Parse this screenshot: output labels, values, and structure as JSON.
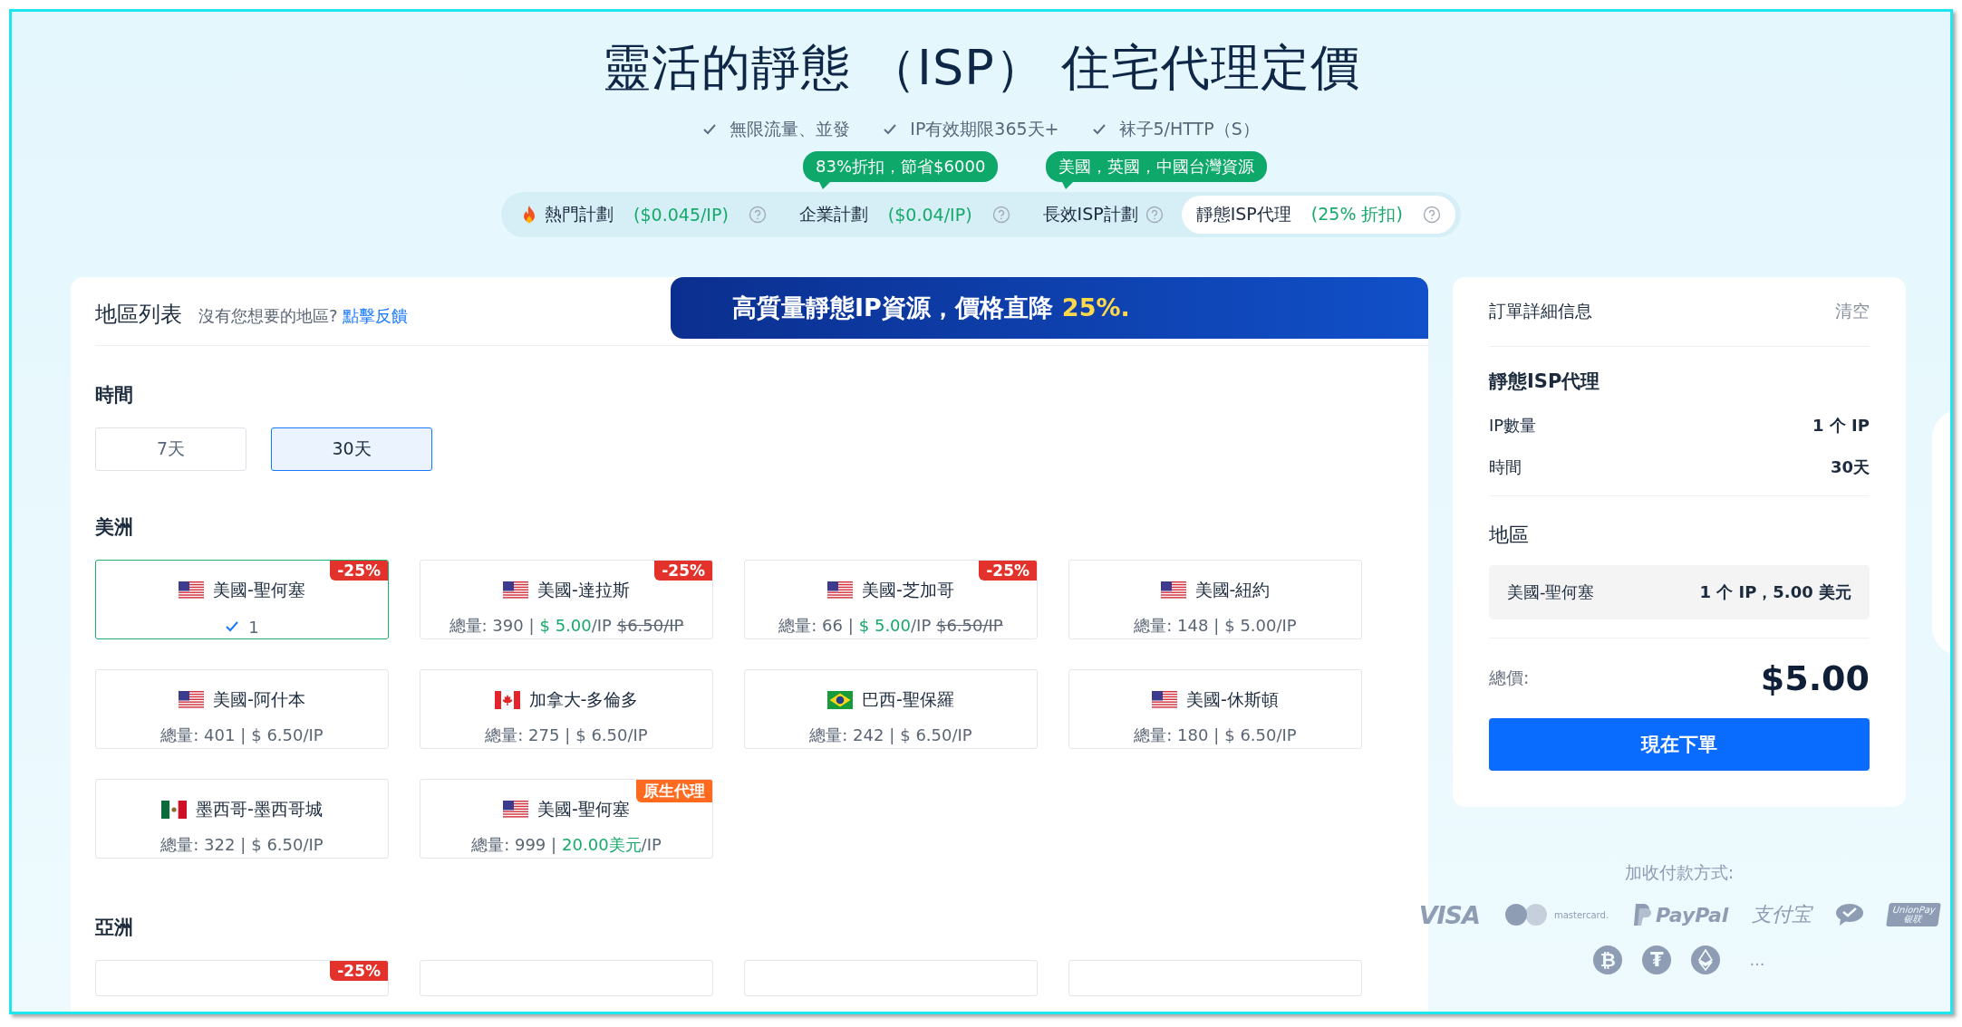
{
  "header": {
    "title": "靈活的靜態 （ISP） 住宅代理定價",
    "features": [
      "無限流量、並發",
      "IP有效期限365天+",
      "袜子5/HTTP（S）"
    ]
  },
  "plans": [
    {
      "kind": "hot",
      "label": "熱門計劃",
      "price": "($0.045/IP)",
      "selected": false
    },
    {
      "kind": "plain",
      "label": "企業計劃",
      "price": "($0.04/IP)",
      "tooltip": "83%折扣，節省$6000",
      "selected": false
    },
    {
      "kind": "plain",
      "label": "長效ISP計劃",
      "tooltip": "美國，英國，中國台灣資源",
      "selected": false
    },
    {
      "kind": "plain",
      "label": "靜態ISP代理",
      "price": "(25% 折扣)",
      "selected": true
    }
  ],
  "region_panel": {
    "title": "地區列表",
    "hint": "沒有您想要的地區?",
    "link": "點擊反饋",
    "banner": {
      "text": "高質量靜態IP資源，價格直降",
      "highlight": "25%."
    }
  },
  "duration": {
    "title": "時間",
    "options": [
      {
        "label": "7天",
        "selected": false
      },
      {
        "label": "30天",
        "selected": true
      }
    ]
  },
  "regions": [
    {
      "title": "美洲",
      "cards": [
        {
          "flag": {
            "kind": "us"
          },
          "name": "美國-聖何塞",
          "badge": {
            "text": "-25%",
            "kind": "discount"
          },
          "selected": true,
          "quantity": "1"
        },
        {
          "flag": {
            "kind": "us"
          },
          "name": "美國-達拉斯",
          "badge": {
            "text": "-25%",
            "kind": "discount"
          },
          "selected": false,
          "total": "總量: 390 |",
          "price": {
            "text": "$ 5.00",
            "kind": "sale"
          },
          "unit": "/IP",
          "old_price": "$6.50/IP"
        },
        {
          "flag": {
            "kind": "us"
          },
          "name": "美國-芝加哥",
          "badge": {
            "text": "-25%",
            "kind": "discount"
          },
          "selected": false,
          "total": "總量: 66 |",
          "price": {
            "text": "$ 5.00",
            "kind": "sale"
          },
          "unit": "/IP",
          "old_price": "$6.50/IP"
        },
        {
          "flag": {
            "kind": "us"
          },
          "name": "美國-紐約",
          "selected": false,
          "total": "總量: 148 |",
          "price": {
            "text": "$ 5.00",
            "kind": "regular"
          },
          "unit": "/IP"
        },
        {
          "flag": {
            "kind": "us"
          },
          "name": "美國-阿什本",
          "selected": false,
          "total": "總量: 401 |",
          "price": {
            "text": "$ 6.50",
            "kind": "regular"
          },
          "unit": "/IP"
        },
        {
          "flag": {
            "kind": "ca"
          },
          "name": "加拿大-多倫多",
          "selected": false,
          "total": "總量: 275 |",
          "price": {
            "text": "$ 6.50",
            "kind": "regular"
          },
          "unit": "/IP"
        },
        {
          "flag": {
            "kind": "br"
          },
          "name": "巴西-聖保羅",
          "selected": false,
          "total": "總量: 242 |",
          "price": {
            "text": "$ 6.50",
            "kind": "regular"
          },
          "unit": "/IP"
        },
        {
          "flag": {
            "kind": "us"
          },
          "name": "美國-休斯頓",
          "selected": false,
          "total": "總量: 180 |",
          "price": {
            "text": "$ 6.50",
            "kind": "regular"
          },
          "unit": "/IP"
        },
        {
          "flag": {
            "kind": "mx"
          },
          "name": "墨西哥-墨西哥城",
          "selected": false,
          "total": "總量: 322 |",
          "price": {
            "text": "$ 6.50",
            "kind": "regular"
          },
          "unit": "/IP"
        },
        {
          "flag": {
            "kind": "us"
          },
          "name": "美國-聖何塞",
          "badge": {
            "text": "原生代理",
            "kind": "native"
          },
          "selected": false,
          "total": "總量: 999 |",
          "price": {
            "text": "20.00美元",
            "kind": "sale"
          },
          "unit": "/IP"
        }
      ]
    },
    {
      "title": "亞洲",
      "cards": [
        {
          "kind": "cut",
          "badge": {
            "text": "-25%",
            "kind": "discount"
          }
        },
        {
          "kind": "cut"
        },
        {
          "kind": "cut"
        },
        {
          "kind": "cut"
        }
      ]
    }
  ],
  "order": {
    "title": "訂單詳細信息",
    "clear": "清空",
    "product": "靜態ISP代理",
    "rows": [
      {
        "label": "IP數量",
        "value": "1 个 IP"
      },
      {
        "label": "時間",
        "value": "30天"
      }
    ],
    "region_title": "地區",
    "region_items": [
      {
        "name": "美國-聖何塞",
        "value": "1 个 IP，5.00 美元"
      }
    ],
    "total_label": "總價:",
    "total": "$5.00",
    "button": "現在下單"
  },
  "payments": {
    "label": "加收付款方式:",
    "methods": [
      {
        "kind": "visa",
        "text": "VISA"
      },
      {
        "kind": "mastercard",
        "text": "mastercard."
      },
      {
        "kind": "paypal",
        "text": "PayPal"
      },
      {
        "kind": "alipay",
        "text": "支付宝"
      },
      {
        "kind": "wechat"
      },
      {
        "kind": "unionpay",
        "text": "UnionPay",
        "subtext": "银联"
      }
    ],
    "crypto": [
      {
        "kind": "bitcoin",
        "symbol": "₿"
      },
      {
        "kind": "tether",
        "symbol": "₮"
      },
      {
        "kind": "ethereum"
      }
    ],
    "more": "..."
  }
}
